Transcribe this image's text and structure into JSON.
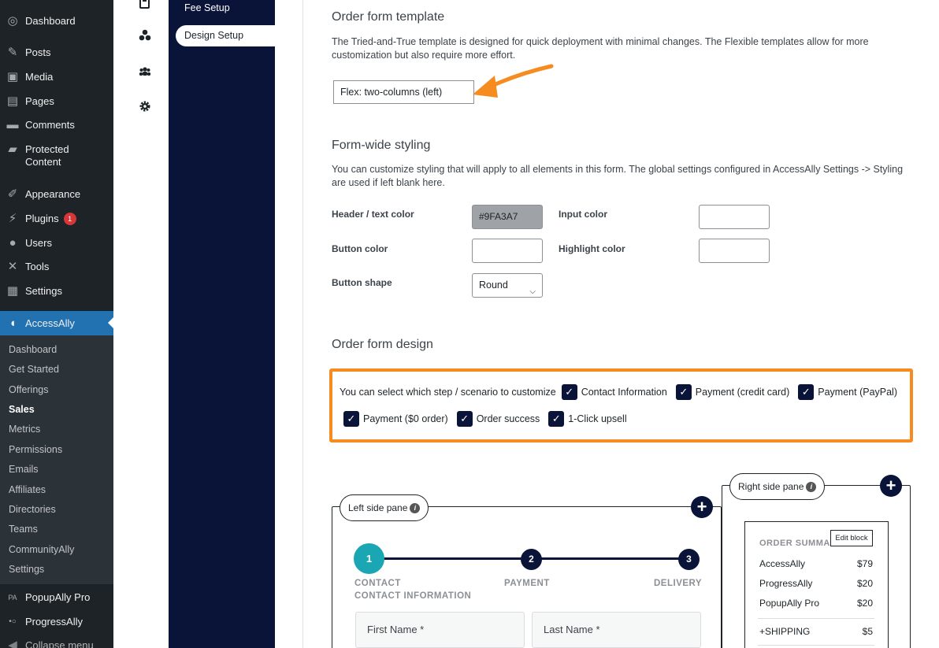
{
  "wp_menu": {
    "items": [
      {
        "label": "Dashboard",
        "icon": "dashboard-icon",
        "glyph": "◎"
      },
      {
        "label": "Posts",
        "icon": "pin-icon",
        "glyph": "✎"
      },
      {
        "label": "Media",
        "icon": "media-icon",
        "glyph": "▣"
      },
      {
        "label": "Pages",
        "icon": "pages-icon",
        "glyph": "▤"
      },
      {
        "label": "Comments",
        "icon": "comments-icon",
        "glyph": "▬"
      },
      {
        "label": "Protected",
        "label2": "Content",
        "icon": "folder-icon",
        "glyph": "▰"
      },
      {
        "label": "Appearance",
        "icon": "brush-icon",
        "glyph": "✐"
      },
      {
        "label": "Plugins",
        "icon": "plugin-icon",
        "glyph": "⚡",
        "badge": "1"
      },
      {
        "label": "Users",
        "icon": "user-icon",
        "glyph": "●"
      },
      {
        "label": "Tools",
        "icon": "wrench-icon",
        "glyph": "✕"
      },
      {
        "label": "Settings",
        "icon": "settings-icon",
        "glyph": "▦"
      },
      {
        "label": "AccessAlly",
        "icon": "accessally-icon",
        "glyph": "◖"
      }
    ],
    "submenu": [
      "Dashboard",
      "Get Started",
      "Offerings",
      "Sales",
      "Metrics",
      "Permissions",
      "Emails",
      "Affiliates",
      "Directories",
      "Teams",
      "CommunityAlly",
      "Settings"
    ],
    "current_sub": "Sales",
    "after": [
      {
        "label": "PopupAlly Pro",
        "icon": "popupally-icon",
        "glyph": "PA"
      },
      {
        "label": "ProgressAlly",
        "icon": "progressally-icon",
        "glyph": "•○"
      },
      {
        "label": "Collapse menu",
        "icon": "collapse-icon",
        "glyph": "◀"
      }
    ]
  },
  "plugin_nav": {
    "fee_setup": "Fee Setup",
    "design_setup": "Design Setup"
  },
  "template_section": {
    "title": "Order form template",
    "description": "The Tried-and-True template is designed for quick deployment with minimal changes. The Flexible templates allow for more customization but also require more effort.",
    "selected": "Flex: two-columns (left)"
  },
  "styling_section": {
    "title": "Form-wide styling",
    "description": "You can customize styling that will apply to all elements in this form. The global settings configured in AccessAlly Settings -> Styling are used if left blank here.",
    "header_color_label": "Header / text color",
    "header_color_value": "#9FA3A7",
    "input_color_label": "Input color",
    "button_color_label": "Button color",
    "highlight_color_label": "Highlight color",
    "button_shape_label": "Button shape",
    "button_shape_value": "Round"
  },
  "design_section": {
    "title": "Order form design",
    "prompt": "You can select which step / scenario to customize",
    "options": [
      "Contact Information",
      "Payment (credit card)",
      "Payment (PayPal)",
      "Payment ($0 order)",
      "Order success",
      "1-Click upsell"
    ]
  },
  "left_pane": {
    "tag": "Left side pane",
    "steps": [
      {
        "num": "1",
        "label": "CONTACT"
      },
      {
        "num": "2",
        "label": "PAYMENT"
      },
      {
        "num": "3",
        "label": "DELIVERY"
      }
    ],
    "sub_label": "CONTACT INFORMATION",
    "first_name": "First Name *",
    "last_name": "Last Name *"
  },
  "right_pane": {
    "tag": "Right side pane",
    "summary_title": "ORDER SUMMA",
    "edit_block": "Edit block",
    "rows": [
      {
        "name": "AccessAlly",
        "price": "$79"
      },
      {
        "name": "ProgressAlly",
        "price": "$20"
      },
      {
        "name": "PopupAlly Pro",
        "price": "$20"
      },
      {
        "name": "+SHIPPING",
        "price": "$5"
      }
    ]
  },
  "colors": {
    "wp_sidebar": "#1d2327",
    "wp_active": "#2271b1",
    "plugin_nav": "#0a1338",
    "highlight_orange": "#f68b1f",
    "step_active": "#1ba6b4"
  }
}
